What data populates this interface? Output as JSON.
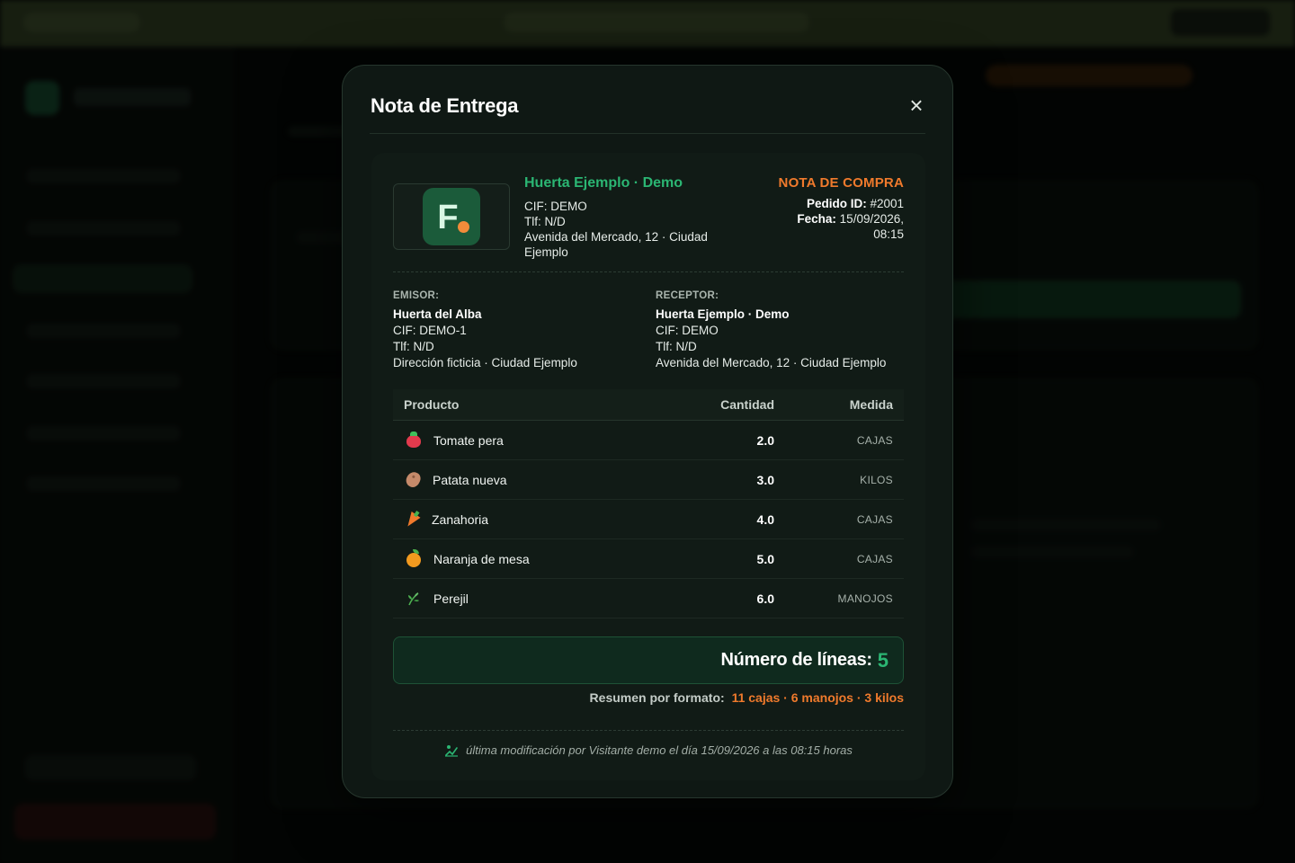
{
  "colors": {
    "accent_green": "#2bb673",
    "accent_orange": "#f07a2c",
    "modal_bg": "#0f1814"
  },
  "modal": {
    "title": "Nota de Entrega",
    "close_icon": "close-icon"
  },
  "company": {
    "name": "Huerta Ejemplo · Demo",
    "cif": "CIF: DEMO",
    "phone": "Tlf: N/D",
    "address": "Avenida del Mercado, 12 · Ciudad Ejemplo",
    "logo_letter": "F"
  },
  "document": {
    "type": "NOTA DE COMPRA",
    "order_label": "Pedido ID:",
    "order_id": "#2001",
    "date_label": "Fecha:",
    "date": "15/09/2026,",
    "time": "08:15"
  },
  "issuer": {
    "label": "EMISOR:",
    "name": "Huerta del Alba",
    "cif": "CIF: DEMO-1",
    "phone": "Tlf: N/D",
    "address": "Dirección ficticia · Ciudad Ejemplo"
  },
  "receiver": {
    "label": "RECEPTOR:",
    "name": "Huerta Ejemplo · Demo",
    "cif": "CIF: DEMO",
    "phone": "Tlf: N/D",
    "address": "Avenida del Mercado, 12 · Ciudad Ejemplo"
  },
  "table": {
    "headers": {
      "product": "Producto",
      "quantity": "Cantidad",
      "unit": "Medida"
    },
    "rows": [
      {
        "icon": "tomato-icon",
        "product": "Tomate pera",
        "quantity": "2.0",
        "unit": "CAJAS"
      },
      {
        "icon": "potato-icon",
        "product": "Patata nueva",
        "quantity": "3.0",
        "unit": "KILOS"
      },
      {
        "icon": "carrot-icon",
        "product": "Zanahoria",
        "quantity": "4.0",
        "unit": "CAJAS"
      },
      {
        "icon": "orange-icon",
        "product": "Naranja de mesa",
        "quantity": "5.0",
        "unit": "CAJAS"
      },
      {
        "icon": "herb-icon",
        "product": "Perejil",
        "quantity": "6.0",
        "unit": "MANOJOS"
      }
    ]
  },
  "totals": {
    "lines_label": "Número de líneas:",
    "lines_value": "5",
    "summary_label": "Resumen por formato:",
    "summary_value": "11 cajas · 6 manojos · 3 kilos"
  },
  "footer": {
    "icon": "edit-icon",
    "note": "última modificación por Visitante demo el día 15/09/2026 a las 08:15 horas"
  }
}
